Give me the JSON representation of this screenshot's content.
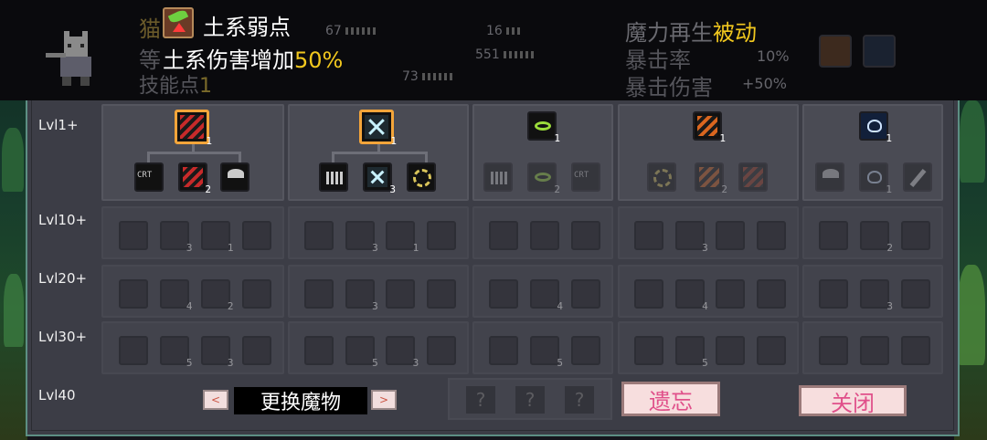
{
  "header": {
    "character_name": "猫",
    "level_label": "等",
    "skill_points_label": "技能点",
    "skill_points_value": "1",
    "stats": {
      "atk": "67",
      "atk2": "16",
      "hp": "551",
      "speed": "73"
    },
    "regen_label": "魔力再生",
    "regen_value": "被动",
    "crit_label": "暴击率",
    "crit_value": "10%",
    "critdmg_label": "暴击伤害",
    "critdmg_value": "+50%"
  },
  "tooltip": {
    "icon": "earth-weakness-icon",
    "title": "土系弱点",
    "desc_prefix": "土系伤害增加",
    "desc_value": "50%"
  },
  "levels": [
    "Lvl1+",
    "Lvl10+",
    "Lvl20+",
    "Lvl30+",
    "Lvl40"
  ],
  "tier1": {
    "branches": [
      {
        "top_count": "1",
        "children": [
          {
            "icon": "crit-icon",
            "count": ""
          },
          {
            "icon": "claw-red-icon",
            "count": "2"
          },
          {
            "icon": "heart-bar-icon",
            "count": ""
          }
        ]
      },
      {
        "top_count": "1",
        "children": [
          {
            "icon": "sword-bar-icon",
            "count": ""
          },
          {
            "icon": "cross-slash-icon",
            "count": "3"
          },
          {
            "icon": "gear-target-icon",
            "count": ""
          }
        ]
      },
      {
        "top_count": "1",
        "children": [
          {
            "icon": "ring-icon",
            "count": ""
          },
          {
            "icon": "ring-icon",
            "count": "2"
          },
          {
            "icon": "crit-icon",
            "count": ""
          }
        ]
      },
      {
        "top_count": "1",
        "children": [
          {
            "icon": "clock-icon",
            "count": ""
          },
          {
            "icon": "claw-orange-icon",
            "count": "2"
          },
          {
            "icon": "flame-icon",
            "count": ""
          }
        ]
      },
      {
        "top_count": "1",
        "children": [
          {
            "icon": "cloud-icon",
            "count": ""
          },
          {
            "icon": "heart-icon",
            "count": "1"
          },
          {
            "icon": "pen-icon",
            "count": ""
          }
        ]
      }
    ]
  },
  "dim_counts": {
    "row10": [
      "3",
      "1",
      "3",
      "1",
      "",
      "",
      "3",
      "",
      "2",
      ""
    ],
    "row20": [
      "4",
      "2",
      "3",
      "",
      "4",
      "",
      "4",
      "",
      "3",
      ""
    ],
    "row30": [
      "5",
      "3",
      "5",
      "3",
      "5",
      "",
      "5",
      "",
      "",
      ""
    ]
  },
  "bottom": {
    "prev_arrow": "<",
    "swap_label": "更换魔物",
    "next_arrow": ">",
    "locked_slots": [
      "?",
      "?",
      "?"
    ],
    "forget_label": "遗忘",
    "close_label": "关闭"
  },
  "colors": {
    "accent_yellow": "#f2c81e",
    "selected_border": "#f4a53a",
    "panel": "#4a4b54",
    "button_bg": "#f7dede",
    "button_text": "#e0508a"
  }
}
